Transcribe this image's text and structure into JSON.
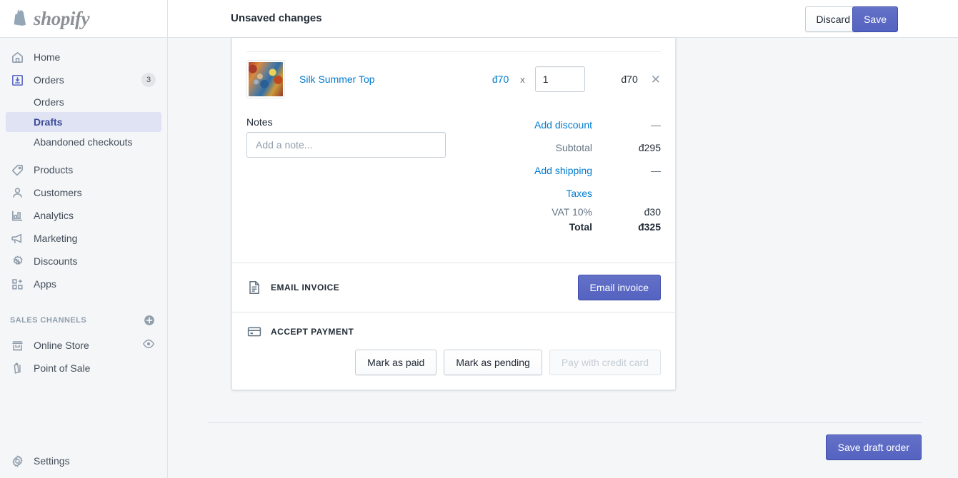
{
  "brand": {
    "name": "shopify",
    "accent": "#5c6ac4",
    "link": "#007ace"
  },
  "sidebar": {
    "items": [
      {
        "label": "Home",
        "icon": "home-icon",
        "badge": ""
      },
      {
        "label": "Orders",
        "icon": "orders-icon",
        "badge": "3"
      },
      {
        "label": "Products",
        "icon": "products-tag-icon",
        "badge": ""
      },
      {
        "label": "Customers",
        "icon": "customers-person-icon",
        "badge": ""
      },
      {
        "label": "Analytics",
        "icon": "analytics-bars-icon",
        "badge": ""
      },
      {
        "label": "Marketing",
        "icon": "marketing-megaphone-icon",
        "badge": ""
      },
      {
        "label": "Discounts",
        "icon": "discounts-percent-icon",
        "badge": ""
      },
      {
        "label": "Apps",
        "icon": "apps-grid-plus-icon",
        "badge": ""
      }
    ],
    "orders_subnav": [
      {
        "label": "Orders",
        "active": false
      },
      {
        "label": "Drafts",
        "active": true
      },
      {
        "label": "Abandoned checkouts",
        "active": false
      }
    ],
    "sales_channels": {
      "title": "SALES CHANNELS",
      "add_icon": "plus-circle-icon",
      "items": [
        {
          "label": "Online Store",
          "icon": "online-store-icon",
          "trailing_icon": "eye-icon"
        },
        {
          "label": "Point of Sale",
          "icon": "point-of-sale-icon",
          "trailing_icon": ""
        }
      ]
    },
    "settings": {
      "label": "Settings",
      "icon": "gear-icon"
    }
  },
  "topbar": {
    "title": "Unsaved changes",
    "discard_label": "Discard",
    "save_label": "Save"
  },
  "order": {
    "line_item": {
      "name": "Silk Summer Top",
      "unit_price": "đ70",
      "multiply_symbol": "x",
      "quantity": "1",
      "line_total": "đ70",
      "remove_icon": "close-icon",
      "thumbnail_alt": "product-thumbnail"
    },
    "notes": {
      "label": "Notes",
      "value": "",
      "placeholder": "Add a note..."
    },
    "totals": [
      {
        "label": "Add discount",
        "value": "—",
        "link": true
      },
      {
        "label": "Subtotal",
        "value": "đ295",
        "link": false
      },
      {
        "label": "Add shipping",
        "value": "—",
        "link": true
      },
      {
        "label": "Taxes",
        "value": "",
        "link": true
      },
      {
        "label": "VAT 10%",
        "value": "đ30",
        "link": false
      },
      {
        "label": "Total",
        "value": "đ325",
        "link": false
      }
    ]
  },
  "email_invoice": {
    "section_title": "EMAIL INVOICE",
    "icon": "document-icon",
    "button_label": "Email invoice"
  },
  "accept_payment": {
    "section_title": "ACCEPT PAYMENT",
    "icon": "credit-card-icon",
    "buttons": [
      {
        "label": "Mark as paid",
        "disabled": false
      },
      {
        "label": "Mark as pending",
        "disabled": false
      },
      {
        "label": "Pay with credit card",
        "disabled": true
      }
    ]
  },
  "footer": {
    "save_draft_label": "Save draft order"
  }
}
